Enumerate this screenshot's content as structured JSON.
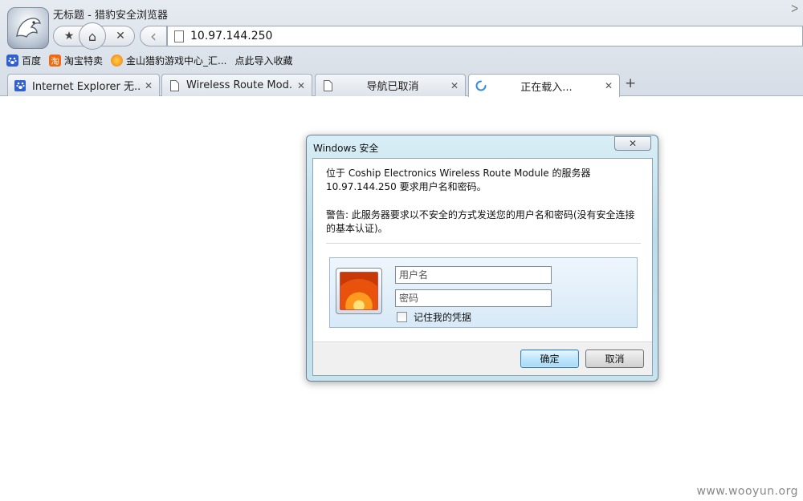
{
  "window": {
    "title": "无标题 - 猎豹安全浏览器",
    "restore_glyph": "ᐳ"
  },
  "toolbar": {
    "star_glyph": "★",
    "home_glyph": "⌂",
    "stop_glyph": "✕",
    "back_glyph": "‹",
    "address_value": "10.97.144.250"
  },
  "bookmarks": [
    {
      "label": "百度",
      "icon": "baidu-paw-icon",
      "color": "#2f5fd0",
      "glyph": "🐾"
    },
    {
      "label": "淘宝特卖",
      "icon": "taobao-icon",
      "color": "#f06a12",
      "glyph": "淘"
    },
    {
      "label": "金山猎豹游戏中心_汇...",
      "icon": "game-center-icon",
      "color": "#f29a17",
      "glyph": "✿"
    },
    {
      "label": "点此导入收藏",
      "icon": "",
      "color": "",
      "glyph": ""
    }
  ],
  "tabs": [
    {
      "label": "Internet Explorer 无...",
      "icon": "baidu-paw-icon",
      "close": "✕"
    },
    {
      "label": "Wireless Route Mod...",
      "icon": "page-icon",
      "close": "✕"
    },
    {
      "label": "导航已取消",
      "icon": "page-icon",
      "close": "✕"
    },
    {
      "label": "正在载入...",
      "icon": "loading-spinner-icon",
      "close": "✕"
    }
  ],
  "new_tab_glyph": "+",
  "dialog": {
    "title": "Windows 安全",
    "close_glyph": "✕",
    "message_line1": "位于 Coship Electronics Wireless Route Module 的服务器",
    "message_line2": "10.97.144.250 要求用户名和密码。",
    "warning_line1": "警告: 此服务器要求以不安全的方式发送您的用户名和密码(没有安全连接",
    "warning_line2": "的基本认证)。",
    "username_placeholder": "用户名",
    "password_placeholder": "密码",
    "remember_label": "记住我的凭据",
    "ok_label": "确定",
    "cancel_label": "取消"
  },
  "watermark": "www.wooyun.org",
  "colors": {
    "dialog_frame": "#bcdde8",
    "primary_button": "#bee6fd"
  }
}
